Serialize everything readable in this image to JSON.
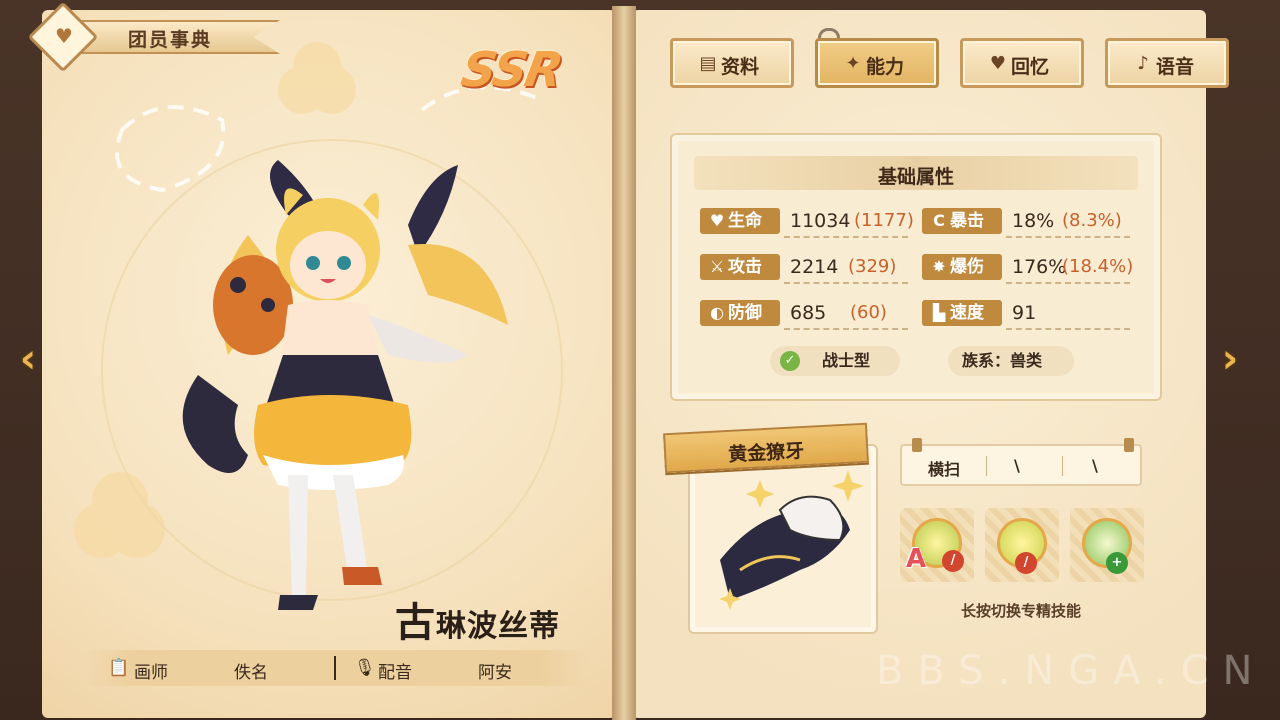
{
  "header": {
    "title": "团员事典"
  },
  "rarity": "SSR",
  "character": {
    "name_first": "古",
    "name_rest": "琳波丝蒂"
  },
  "credits": {
    "artist_label": "画师",
    "artist_value": "佚名",
    "voice_label": "配音",
    "voice_value": "阿安"
  },
  "tabs": [
    {
      "label": "资料",
      "icon": "notebook-icon",
      "active": false
    },
    {
      "label": "能力",
      "icon": "claw-icon",
      "active": true
    },
    {
      "label": "回忆",
      "icon": "heart-icon",
      "active": false
    },
    {
      "label": "语音",
      "icon": "microphone-icon",
      "active": false
    }
  ],
  "attributes": {
    "title": "基础属性",
    "stats": [
      {
        "label": "生命",
        "icon": "heart-icon",
        "value": "11034",
        "bonus": "(1177)"
      },
      {
        "label": "暴击",
        "icon": "crit-icon",
        "value": "18%",
        "bonus": "(8.3%)"
      },
      {
        "label": "攻击",
        "icon": "sword-icon",
        "value": "2214",
        "bonus": "(329)"
      },
      {
        "label": "爆伤",
        "icon": "burst-icon",
        "value": "176%",
        "bonus": "(18.4%)"
      },
      {
        "label": "防御",
        "icon": "shield-icon",
        "value": "685",
        "bonus": "(60)"
      },
      {
        "label": "速度",
        "icon": "boot-icon",
        "value": "91",
        "bonus": ""
      }
    ],
    "class_type": "战士型",
    "race": "族系：兽类"
  },
  "weapon": {
    "name": "黄金獠牙"
  },
  "skills": {
    "tabs": [
      "横扫",
      "\\",
      "\\"
    ],
    "slots": [
      {
        "letter": "A",
        "badge": "/",
        "badge_color": "#d2452f"
      },
      {
        "letter": "",
        "badge": "/",
        "badge_color": "#d2452f"
      },
      {
        "letter": "",
        "badge": "+",
        "badge_color": "#3a9a3a"
      }
    ],
    "hint": "长按切换专精技能"
  },
  "watermark": "BBS.NGA.CN",
  "colors": {
    "accent": "#c08a3e",
    "bonus": "#c8622c",
    "page": "#f6e6c6"
  }
}
